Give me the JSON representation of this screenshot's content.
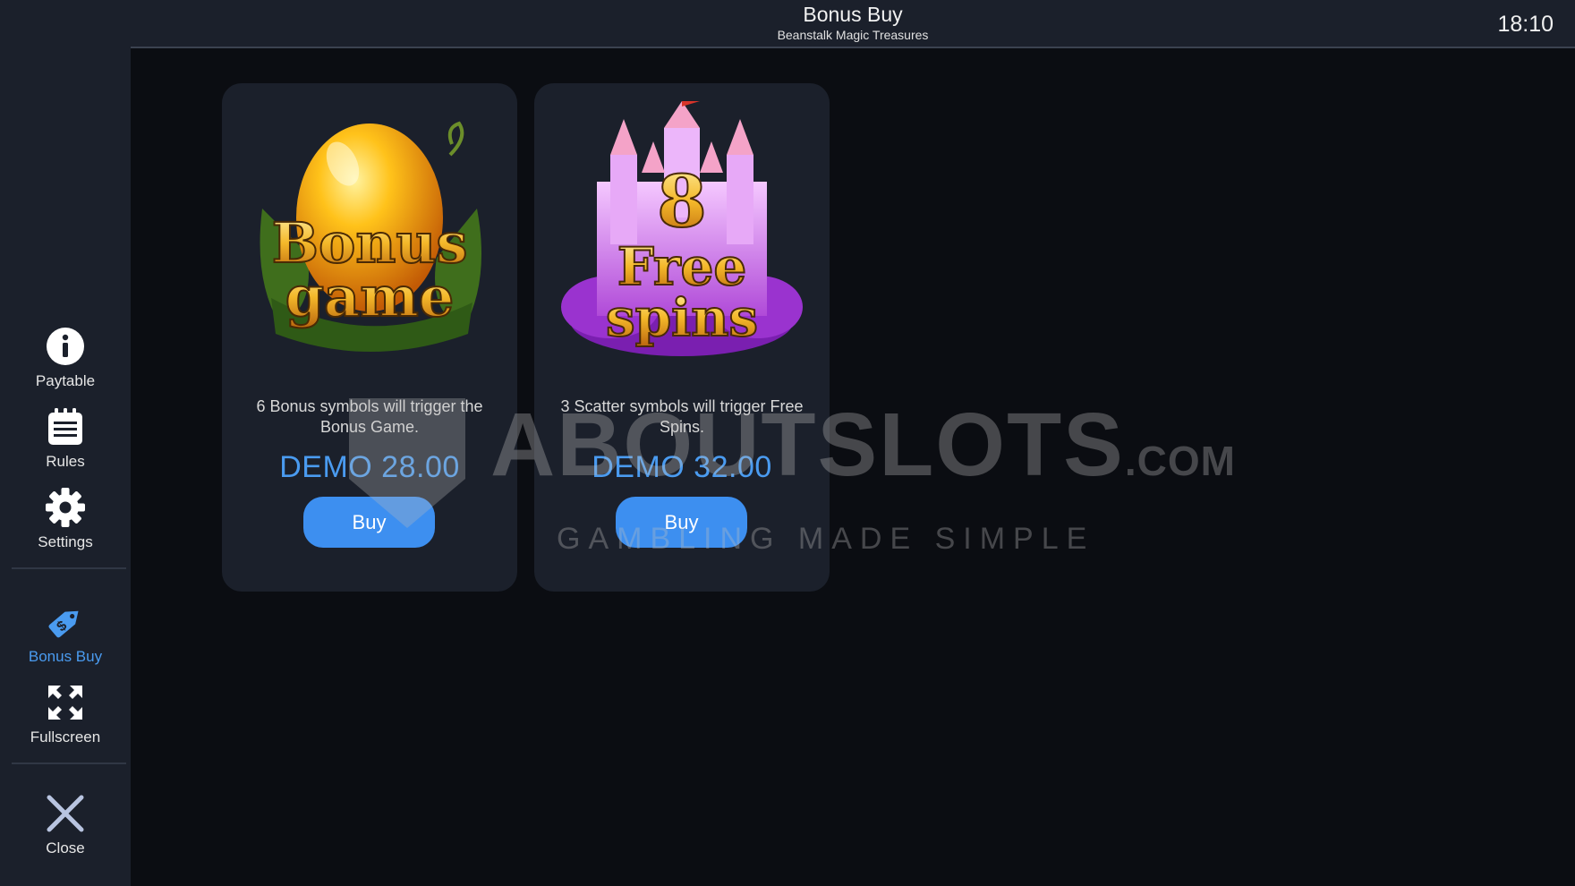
{
  "header": {
    "title": "Bonus Buy",
    "subtitle": "Beanstalk Magic Treasures",
    "clock": "18:10"
  },
  "sidebar": {
    "items": [
      {
        "label": "Paytable",
        "icon": "info-icon",
        "active": false
      },
      {
        "label": "Rules",
        "icon": "rules-icon",
        "active": false
      },
      {
        "label": "Settings",
        "icon": "gear-icon",
        "active": false
      },
      {
        "label": "Bonus Buy",
        "icon": "price-tag-icon",
        "active": true
      },
      {
        "label": "Fullscreen",
        "icon": "fullscreen-icon",
        "active": false
      },
      {
        "label": "Close",
        "icon": "close-icon",
        "active": false
      }
    ]
  },
  "cards": [
    {
      "art_text_line1": "Bonus",
      "art_text_line2": "game",
      "description": "6 Bonus symbols will trigger the Bonus Game.",
      "price": "DEMO 28.00",
      "button": "Buy"
    },
    {
      "art_text_number": "8",
      "art_text_line1": "Free",
      "art_text_line2": "spins",
      "description": "3 Scatter symbols will trigger Free Spins.",
      "price": "DEMO 32.00",
      "button": "Buy"
    }
  ],
  "watermark": {
    "brand": "ABOUTSLOTS",
    "domain": ".COM",
    "tagline": "GAMBLING MADE SIMPLE"
  },
  "colors": {
    "accent": "#4a9bf0",
    "button": "#3d8ff0",
    "panel": "#1b202b",
    "background": "#0b0d12"
  }
}
